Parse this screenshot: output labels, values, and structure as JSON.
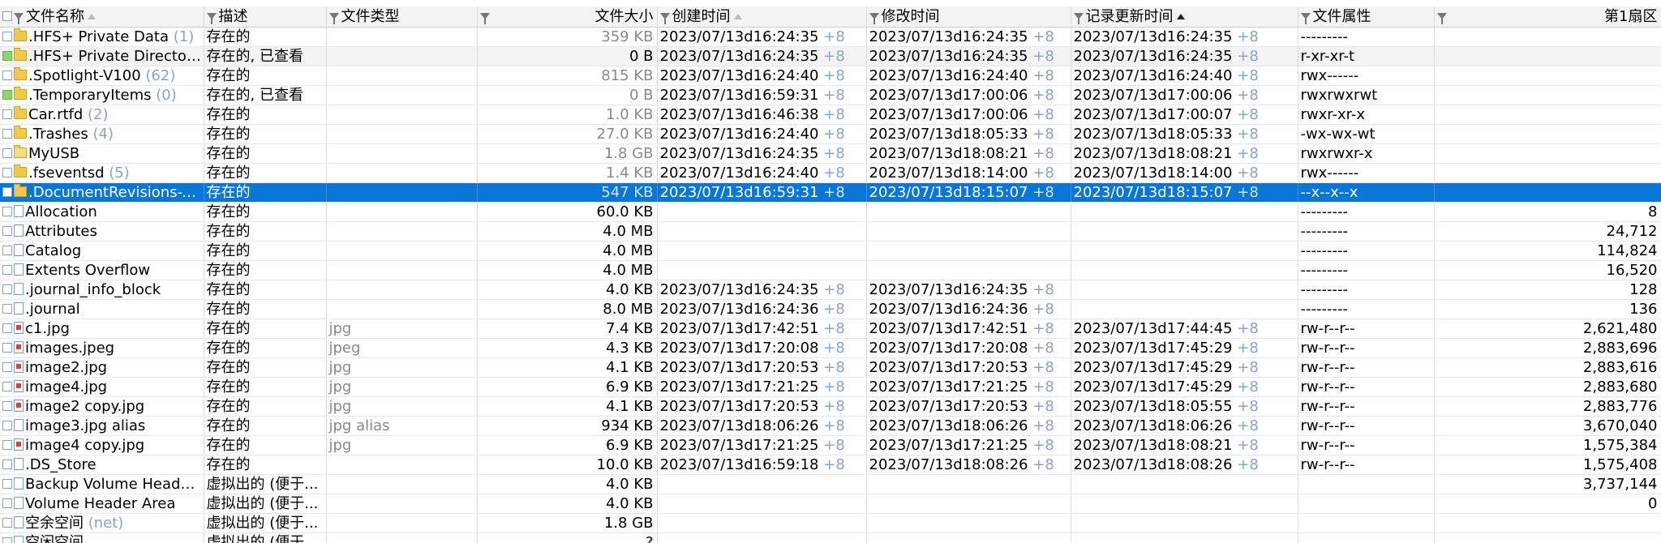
{
  "columns": {
    "name": "文件名称",
    "desc": "描述",
    "type": "文件类型",
    "size": "文件大小",
    "created": "创建时间",
    "modified": "修改时间",
    "record_updated": "记录更新时间",
    "attrs": "文件属性",
    "first_sector": "第1扇区"
  },
  "tz": "+8",
  "rows": [
    {
      "icon": "folder",
      "name": ".HFS+ Private Data",
      "count": "(1)",
      "desc": "存在的",
      "type": "",
      "size": "359 KB",
      "size_muted": true,
      "created": "2023/07/13d16:24:35",
      "modified": "2023/07/13d16:24:35",
      "record_updated": "2023/07/13d16:24:35",
      "attrs": "---------",
      "first_sector": "",
      "check_green": false
    },
    {
      "icon": "folder",
      "name": ".HFS+ Private Director...",
      "count": "",
      "desc": "存在的, 已查看",
      "type": "",
      "size": "0 B",
      "size_muted": false,
      "created": "2023/07/13d16:24:35",
      "modified": "2023/07/13d16:24:35",
      "record_updated": "2023/07/13d16:24:35",
      "attrs": "r-xr-xr-t",
      "first_sector": "",
      "check_green": true,
      "soft": true
    },
    {
      "icon": "folder",
      "name": ".Spotlight-V100",
      "count": "(62)",
      "desc": "存在的",
      "type": "",
      "size": "815 KB",
      "size_muted": true,
      "created": "2023/07/13d16:24:40",
      "modified": "2023/07/13d16:24:40",
      "record_updated": "2023/07/13d16:24:40",
      "attrs": "rwx------",
      "first_sector": "",
      "check_green": false
    },
    {
      "icon": "folder",
      "name": ".TemporaryItems",
      "count": "(0)",
      "desc": "存在的, 已查看",
      "type": "",
      "size": "0 B",
      "size_muted": true,
      "created": "2023/07/13d16:59:31",
      "modified": "2023/07/13d17:00:06",
      "record_updated": "2023/07/13d17:00:06",
      "attrs": "rwxrwxrwt",
      "first_sector": "",
      "check_green": true
    },
    {
      "icon": "folder",
      "name": "Car.rtfd",
      "count": "(2)",
      "desc": "存在的",
      "type": "",
      "size": "1.0 KB",
      "size_muted": true,
      "created": "2023/07/13d16:46:38",
      "modified": "2023/07/13d17:00:06",
      "record_updated": "2023/07/13d17:00:07",
      "attrs": "rwxr-xr-x",
      "first_sector": "",
      "check_green": false
    },
    {
      "icon": "folder",
      "name": ".Trashes",
      "count": "(4)",
      "desc": "存在的",
      "type": "",
      "size": "27.0 KB",
      "size_muted": true,
      "created": "2023/07/13d16:24:40",
      "modified": "2023/07/13d18:05:33",
      "record_updated": "2023/07/13d18:05:33",
      "attrs": "-wx-wx-wt",
      "first_sector": "",
      "check_green": false
    },
    {
      "icon": "folder-alias",
      "name": "MyUSB",
      "count": "",
      "desc": "存在的",
      "type": "",
      "size": "1.8 GB",
      "size_muted": true,
      "created": "2023/07/13d16:24:35",
      "modified": "2023/07/13d18:08:21",
      "record_updated": "2023/07/13d18:08:21",
      "attrs": "rwxrwxr-x",
      "first_sector": "",
      "check_green": false
    },
    {
      "icon": "folder",
      "name": ".fseventsd",
      "count": "(5)",
      "desc": "存在的",
      "type": "",
      "size": "1.4 KB",
      "size_muted": true,
      "created": "2023/07/13d16:24:40",
      "modified": "2023/07/13d18:14:00",
      "record_updated": "2023/07/13d18:14:00",
      "attrs": "rwx------",
      "first_sector": "",
      "check_green": false
    },
    {
      "icon": "folder",
      "name": ".DocumentRevisions-V...",
      "count": "",
      "desc": "存在的",
      "type": "",
      "size": "547 KB",
      "size_muted": true,
      "created": "2023/07/13d16:59:31",
      "modified": "2023/07/13d18:15:07",
      "record_updated": "2023/07/13d18:15:07",
      "attrs": "--x--x--x",
      "first_sector": "",
      "check_green": false,
      "selected": true
    },
    {
      "icon": "file",
      "name": "Allocation",
      "count": "",
      "desc": "存在的",
      "type": "",
      "size": "60.0 KB",
      "size_muted": false,
      "created": "",
      "modified": "",
      "record_updated": "",
      "attrs": "---------",
      "first_sector": "8",
      "check_green": false
    },
    {
      "icon": "file",
      "name": "Attributes",
      "count": "",
      "desc": "存在的",
      "type": "",
      "size": "4.0 MB",
      "size_muted": false,
      "created": "",
      "modified": "",
      "record_updated": "",
      "attrs": "---------",
      "first_sector": "24,712",
      "check_green": false
    },
    {
      "icon": "file",
      "name": "Catalog",
      "count": "",
      "desc": "存在的",
      "type": "",
      "size": "4.0 MB",
      "size_muted": false,
      "created": "",
      "modified": "",
      "record_updated": "",
      "attrs": "---------",
      "first_sector": "114,824",
      "check_green": false
    },
    {
      "icon": "file",
      "name": "Extents Overflow",
      "count": "",
      "desc": "存在的",
      "type": "",
      "size": "4.0 MB",
      "size_muted": false,
      "created": "",
      "modified": "",
      "record_updated": "",
      "attrs": "---------",
      "first_sector": "16,520",
      "check_green": false
    },
    {
      "icon": "file",
      "name": ".journal_info_block",
      "count": "",
      "desc": "存在的",
      "type": "",
      "size": "4.0 KB",
      "size_muted": false,
      "created": "2023/07/13d16:24:35",
      "modified": "2023/07/13d16:24:35",
      "record_updated": "",
      "attrs": "---------",
      "first_sector": "128",
      "check_green": false
    },
    {
      "icon": "file",
      "name": ".journal",
      "count": "",
      "desc": "存在的",
      "type": "",
      "size": "8.0 MB",
      "size_muted": false,
      "created": "2023/07/13d16:24:36",
      "modified": "2023/07/13d16:24:36",
      "record_updated": "",
      "attrs": "---------",
      "first_sector": "136",
      "check_green": false
    },
    {
      "icon": "image",
      "name": "c1.jpg",
      "count": "",
      "desc": "存在的",
      "type": "jpg",
      "size": "7.4 KB",
      "size_muted": false,
      "created": "2023/07/13d17:42:51",
      "modified": "2023/07/13d17:42:51",
      "record_updated": "2023/07/13d17:44:45",
      "attrs": "rw-r--r--",
      "first_sector": "2,621,480",
      "check_green": false
    },
    {
      "icon": "image",
      "name": "images.jpeg",
      "count": "",
      "desc": "存在的",
      "type": "jpeg",
      "size": "4.3 KB",
      "size_muted": false,
      "created": "2023/07/13d17:20:08",
      "modified": "2023/07/13d17:20:08",
      "record_updated": "2023/07/13d17:45:29",
      "attrs": "rw-r--r--",
      "first_sector": "2,883,696",
      "check_green": false
    },
    {
      "icon": "image",
      "name": "image2.jpg",
      "count": "",
      "desc": "存在的",
      "type": "jpg",
      "size": "4.1 KB",
      "size_muted": false,
      "created": "2023/07/13d17:20:53",
      "modified": "2023/07/13d17:20:53",
      "record_updated": "2023/07/13d17:45:29",
      "attrs": "rw-r--r--",
      "first_sector": "2,883,616",
      "check_green": false
    },
    {
      "icon": "image",
      "name": "image4.jpg",
      "count": "",
      "desc": "存在的",
      "type": "jpg",
      "size": "6.9 KB",
      "size_muted": false,
      "created": "2023/07/13d17:21:25",
      "modified": "2023/07/13d17:21:25",
      "record_updated": "2023/07/13d17:45:29",
      "attrs": "rw-r--r--",
      "first_sector": "2,883,680",
      "check_green": false
    },
    {
      "icon": "image",
      "name": "image2 copy.jpg",
      "count": "",
      "desc": "存在的",
      "type": "jpg",
      "size": "4.1 KB",
      "size_muted": false,
      "created": "2023/07/13d17:20:53",
      "modified": "2023/07/13d17:20:53",
      "record_updated": "2023/07/13d18:05:55",
      "attrs": "rw-r--r--",
      "first_sector": "2,883,776",
      "check_green": false
    },
    {
      "icon": "file",
      "name": "image3.jpg alias",
      "count": "",
      "desc": "存在的",
      "type": "jpg alias",
      "size": "934 KB",
      "size_muted": false,
      "created": "2023/07/13d18:06:26",
      "modified": "2023/07/13d18:06:26",
      "record_updated": "2023/07/13d18:06:26",
      "attrs": "rw-r--r--",
      "first_sector": "3,670,040",
      "check_green": false
    },
    {
      "icon": "image",
      "name": "image4 copy.jpg",
      "count": "",
      "desc": "存在的",
      "type": "jpg",
      "size": "6.9 KB",
      "size_muted": false,
      "created": "2023/07/13d17:21:25",
      "modified": "2023/07/13d17:21:25",
      "record_updated": "2023/07/13d18:08:21",
      "attrs": "rw-r--r--",
      "first_sector": "1,575,384",
      "check_green": false
    },
    {
      "icon": "file",
      "name": ".DS_Store",
      "count": "",
      "desc": "存在的",
      "type": "",
      "size": "10.0 KB",
      "size_muted": false,
      "created": "2023/07/13d16:59:18",
      "modified": "2023/07/13d18:08:26",
      "record_updated": "2023/07/13d18:08:26",
      "attrs": "rw-r--r--",
      "first_sector": "1,575,408",
      "check_green": false
    },
    {
      "icon": "file",
      "name": "Backup Volume Heade...",
      "count": "",
      "desc": "虚拟出的 (便于...",
      "type": "",
      "size": "4.0 KB",
      "size_muted": false,
      "created": "",
      "modified": "",
      "record_updated": "",
      "attrs": "",
      "first_sector": "3,737,144",
      "check_green": false
    },
    {
      "icon": "file",
      "name": "Volume Header Area",
      "count": "",
      "desc": "虚拟出的 (便于...",
      "type": "",
      "size": "4.0 KB",
      "size_muted": false,
      "created": "",
      "modified": "",
      "record_updated": "",
      "attrs": "",
      "first_sector": "0",
      "check_green": false
    },
    {
      "icon": "file",
      "name": "空余空间",
      "count": "(net)",
      "desc": "虚拟出的 (便于...",
      "type": "",
      "size": "1.8 GB",
      "size_muted": false,
      "created": "",
      "modified": "",
      "record_updated": "",
      "attrs": "",
      "first_sector": "",
      "check_green": false
    },
    {
      "icon": "file",
      "name": "空闲空间",
      "count": "",
      "desc": "虚拟出的 (便于...",
      "type": "",
      "size": "?",
      "size_muted": false,
      "created": "",
      "modified": "",
      "record_updated": "",
      "attrs": "",
      "first_sector": "",
      "check_green": false
    }
  ],
  "colors": {
    "selection": "#0a77d6",
    "timezone_text": "#8ea3c3",
    "folder": "#f2c94c"
  }
}
